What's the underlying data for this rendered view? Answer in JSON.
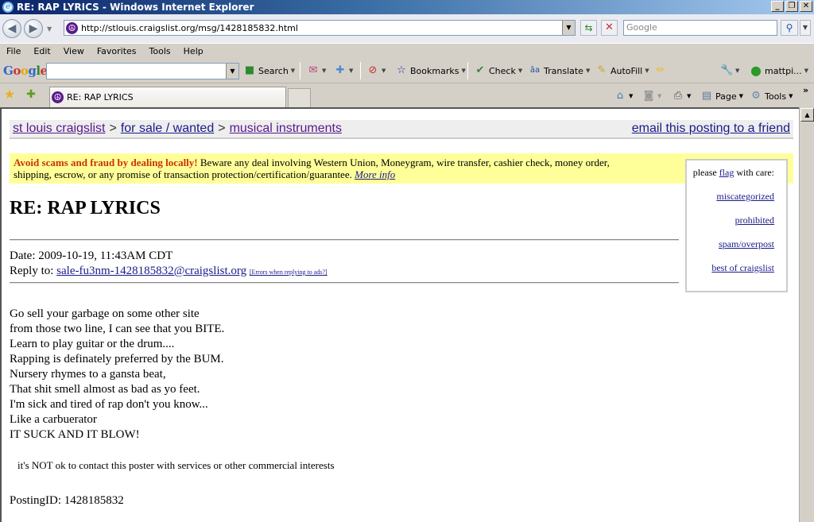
{
  "window": {
    "title": "RE: RAP LYRICS - Windows Internet Explorer",
    "controls": [
      "_",
      "❐",
      "✕"
    ]
  },
  "address_bar": {
    "url": "http://stlouis.craigslist.org/msg/1428185832.html",
    "search_placeholder": "Google"
  },
  "menu": [
    "File",
    "Edit",
    "View",
    "Favorites",
    "Tools",
    "Help"
  ],
  "google_toolbar": {
    "logo": "Google",
    "search_label": "Search",
    "bookmarks_label": "Bookmarks",
    "check_label": "Check",
    "translate_label": "Translate",
    "autofill_label": "AutoFill",
    "account_label": "mattpi..."
  },
  "tabs": {
    "active_tab": "RE: RAP LYRICS",
    "page_label": "Page",
    "tools_label": "Tools",
    "chevron": "»"
  },
  "page": {
    "breadcrumb": [
      "st louis craigslist",
      "for sale / wanted",
      "musical instruments"
    ],
    "breadcrumb_sep": ">",
    "email_link": "email this posting to a friend",
    "warning_bold": "Avoid scams and fraud by dealing locally!",
    "warning_text": " Beware any deal involving Western Union, Moneygram, wire transfer, cashier check, money order, shipping, escrow, or any promise of transaction protection/certification/guarantee. ",
    "warning_link": "More info",
    "flag": {
      "prefix": "please ",
      "link": "flag",
      "suffix": " with care:",
      "options": [
        "miscategorized",
        "prohibited",
        "spam/overpost",
        "best of craigslist"
      ]
    },
    "title": "RE: RAP LYRICS",
    "date": "Date: 2009-10-19, 11:43AM CDT",
    "reply_label": "Reply to: ",
    "reply_email": "sale-fu3nm-1428185832@craigslist.org",
    "reply_errors": "[Errors when replying to ads?]",
    "body_lines": [
      "Go sell your garbage on some other site",
      "from those two line, I can see that you BITE.",
      "Learn to play guitar or the drum....",
      "Rapping is definately preferred by the BUM.",
      "Nursery rhymes to a gansta beat,",
      "That shit smell almost as bad as yo feet.",
      "I'm sick and tired of rap don't you know...",
      "Like a carbuerator",
      "IT SUCK AND IT BLOW!"
    ],
    "notice": "it's NOT ok to contact this poster with services or other commercial interests",
    "posting_id": "PostingID: 1428185832"
  }
}
